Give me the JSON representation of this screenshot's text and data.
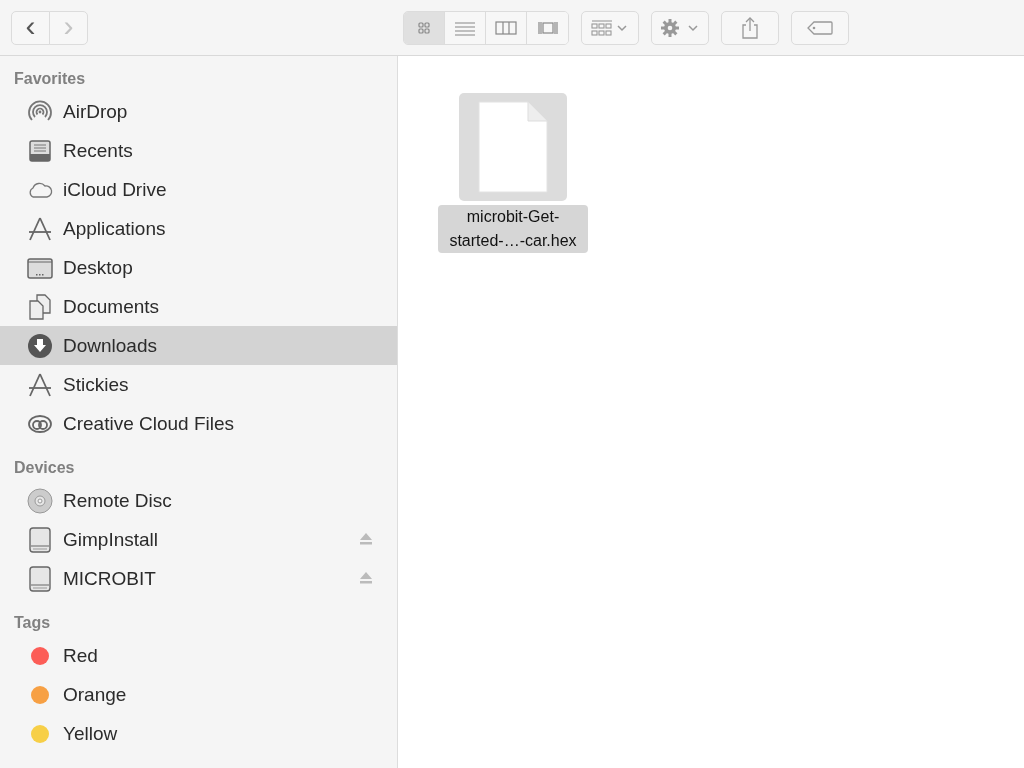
{
  "toolbar": {
    "nav": [
      {
        "label": "‹",
        "disabled": false
      },
      {
        "label": "›",
        "disabled": true
      }
    ],
    "views": [
      {
        "selected": true
      },
      {
        "selected": false
      },
      {
        "selected": false
      },
      {
        "selected": false
      }
    ]
  },
  "sidebar": {
    "sections": [
      {
        "title": "Favorites",
        "kind": "place",
        "items": [
          {
            "label": "AirDrop",
            "selected": false
          },
          {
            "label": "Recents",
            "selected": false
          },
          {
            "label": "iCloud Drive",
            "selected": false
          },
          {
            "label": "Applications",
            "selected": false
          },
          {
            "label": "Desktop",
            "selected": false
          },
          {
            "label": "Documents",
            "selected": false
          },
          {
            "label": "Downloads",
            "selected": true
          },
          {
            "label": "Stickies",
            "selected": false
          },
          {
            "label": "Creative Cloud Files",
            "selected": false
          }
        ]
      },
      {
        "title": "Devices",
        "kind": "device",
        "items": [
          {
            "label": "Remote Disc",
            "selected": false,
            "ejectable": false
          },
          {
            "label": "GimpInstall",
            "selected": false,
            "ejectable": true
          },
          {
            "label": "MICROBIT",
            "selected": false,
            "ejectable": true
          }
        ]
      },
      {
        "title": "Tags",
        "kind": "tag",
        "items": [
          {
            "label": "Red",
            "selected": false,
            "color": "#fc5d57"
          },
          {
            "label": "Orange",
            "selected": false,
            "color": "#f7a044"
          },
          {
            "label": "Yellow",
            "selected": false,
            "color": "#f7cf47"
          }
        ]
      }
    ]
  },
  "files": [
    {
      "name": "microbit-Get-started-…-car.hex",
      "selected": true
    }
  ]
}
